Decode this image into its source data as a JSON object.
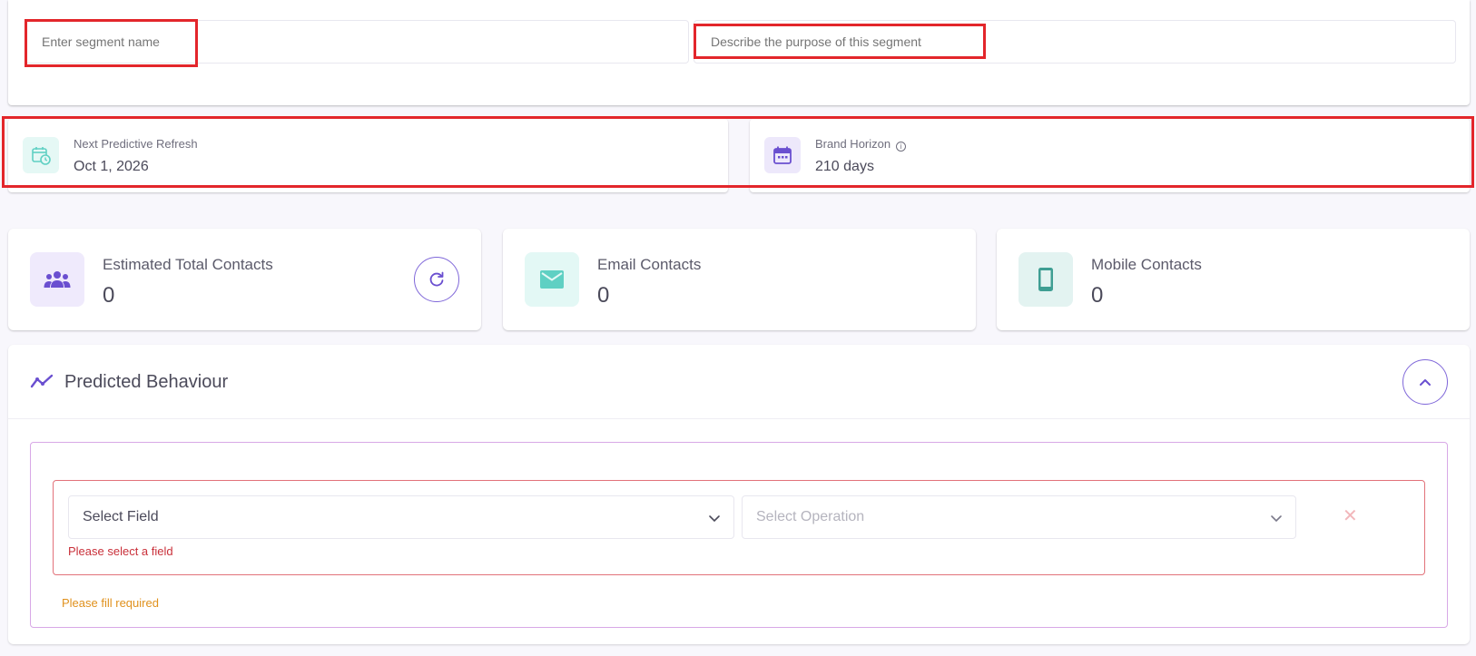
{
  "segment": {
    "name_placeholder": "Enter segment name",
    "description_placeholder": "Describe the purpose of this segment"
  },
  "refresh": {
    "next_label": "Next Predictive Refresh",
    "next_value": "Oct 1, 2026",
    "horizon_label": "Brand Horizon",
    "horizon_value": "210 days"
  },
  "stats": [
    {
      "label": "Estimated Total Contacts",
      "value": "0",
      "icon": "users-icon"
    },
    {
      "label": "Email Contacts",
      "value": "0",
      "icon": "email-icon"
    },
    {
      "label": "Mobile Contacts",
      "value": "0",
      "icon": "mobile-icon"
    }
  ],
  "predicted": {
    "title": "Predicted Behaviour",
    "field_select": "Select Field",
    "operation_select": "Select Operation",
    "field_error": "Please select a field",
    "required_error": "Please fill required"
  },
  "colors": {
    "accent": "#7f67d9",
    "teal": "#5fd0c3",
    "annotation": "#e3262b",
    "error": "#c9303a",
    "warning": "#e0911d"
  }
}
